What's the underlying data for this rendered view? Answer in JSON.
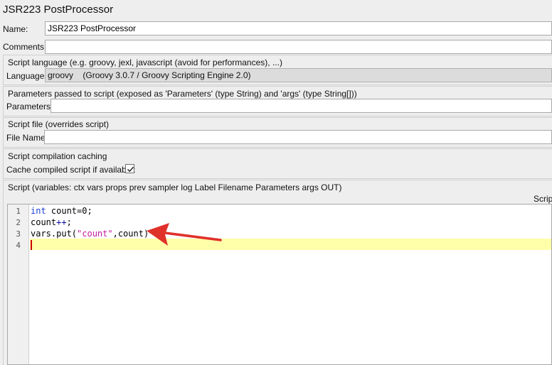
{
  "header": {
    "title": "JSR223 PostProcessor"
  },
  "name_row": {
    "label": "Name:",
    "value": "JSR223 PostProcessor"
  },
  "comments_row": {
    "label": "Comments:",
    "value": ""
  },
  "script_language": {
    "group_title": "Script language (e.g. groovy, jexl, javascript (avoid for performances), ...)",
    "label": "Language:",
    "value": "groovy",
    "engine": "(Groovy 3.0.7 / Groovy Scripting Engine 2.0)"
  },
  "parameters": {
    "group_title": "Parameters passed to script (exposed as 'Parameters' (type String) and 'args' (type String[]))",
    "label": "Parameters:",
    "value": ""
  },
  "script_file": {
    "group_title": "Script file (overrides script)",
    "label": "File Name:",
    "value": ""
  },
  "caching": {
    "group_title": "Script compilation caching",
    "label": "Cache compiled script if available:",
    "checked": true
  },
  "script": {
    "group_title": "Script (variables: ctx vars props prev sampler log Label Filename Parameters args OUT)",
    "right_label": "Script",
    "lines": [
      {
        "num": "1",
        "kw": "int",
        "rest": " count=0;"
      },
      {
        "num": "2",
        "a": "count",
        "op": "++",
        "b": ";"
      },
      {
        "num": "3",
        "a": "vars.put(",
        "str": "\"count\"",
        "b": ",count)"
      },
      {
        "num": "4"
      }
    ],
    "current_line": 4
  },
  "colors": {
    "highlight": "#ffffaa",
    "keyword": "#1a3fd6",
    "string": "#c21a9a",
    "arrow": "#e0302a"
  },
  "annotation": {
    "icon": "red-arrow-icon"
  }
}
